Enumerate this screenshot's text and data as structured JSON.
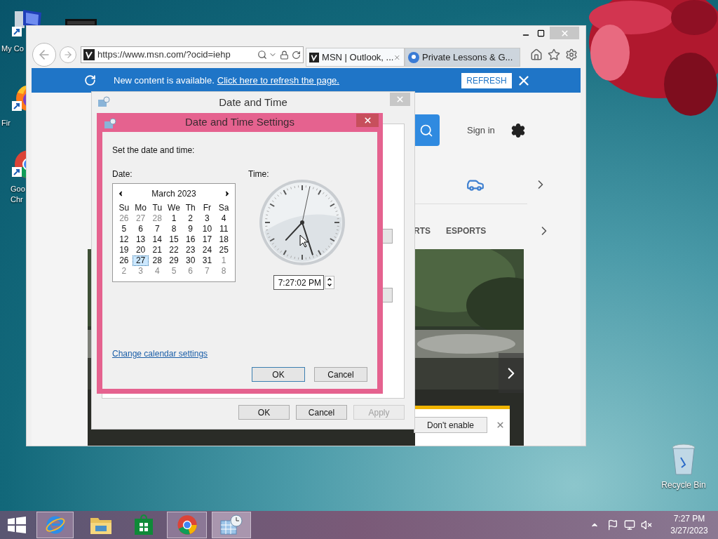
{
  "desktop": {
    "icons": [
      {
        "kind": "computer",
        "lines": [
          "My Co"
        ]
      },
      {
        "kind": "firefox",
        "lines": [
          "Fir"
        ]
      },
      {
        "kind": "chrome",
        "lines": [
          "Goo",
          "Chr"
        ]
      }
    ],
    "recycle_bin": {
      "label": "Recycle Bin"
    }
  },
  "browser": {
    "address": "https://www.msn.com/?ocid=iehp",
    "tabs": [
      {
        "label": "MSN | Outlook, ...",
        "selected": true
      },
      {
        "label": "Private Lessons & G...",
        "selected": false
      }
    ],
    "banner": {
      "text": "New content is available.",
      "link": "Click here to refresh the page.",
      "button": "REFRESH"
    },
    "page": {
      "sign_in": "Sign in",
      "nav_items": [
        "RTS",
        "ESPORTS"
      ],
      "notification": {
        "button": "Don't enable"
      }
    }
  },
  "date_time_window": {
    "title": "Date and Time",
    "buttons": [
      {
        "label": "OK",
        "disabled": false
      },
      {
        "label": "Cancel",
        "disabled": false
      },
      {
        "label": "Apply",
        "disabled": true
      }
    ]
  },
  "settings_dialog": {
    "title": "Date and Time Settings",
    "prompt": "Set the date and time:",
    "date_label": "Date:",
    "time_label": "Time:",
    "calendar": {
      "month": "March 2023",
      "weekdays": [
        "Su",
        "Mo",
        "Tu",
        "We",
        "Th",
        "Fr",
        "Sa"
      ],
      "weeks": [
        [
          {
            "day": "26",
            "other_month": true,
            "selected": false
          },
          {
            "day": "27",
            "other_month": true,
            "selected": false
          },
          {
            "day": "28",
            "other_month": true,
            "selected": false
          },
          {
            "day": "1",
            "other_month": false,
            "selected": false
          },
          {
            "day": "2",
            "other_month": false,
            "selected": false
          },
          {
            "day": "3",
            "other_month": false,
            "selected": false
          },
          {
            "day": "4",
            "other_month": false,
            "selected": false
          }
        ],
        [
          {
            "day": "5",
            "other_month": false,
            "selected": false
          },
          {
            "day": "6",
            "other_month": false,
            "selected": false
          },
          {
            "day": "7",
            "other_month": false,
            "selected": false
          },
          {
            "day": "8",
            "other_month": false,
            "selected": false
          },
          {
            "day": "9",
            "other_month": false,
            "selected": false
          },
          {
            "day": "10",
            "other_month": false,
            "selected": false
          },
          {
            "day": "11",
            "other_month": false,
            "selected": false
          }
        ],
        [
          {
            "day": "12",
            "other_month": false,
            "selected": false
          },
          {
            "day": "13",
            "other_month": false,
            "selected": false
          },
          {
            "day": "14",
            "other_month": false,
            "selected": false
          },
          {
            "day": "15",
            "other_month": false,
            "selected": false
          },
          {
            "day": "16",
            "other_month": false,
            "selected": false
          },
          {
            "day": "17",
            "other_month": false,
            "selected": false
          },
          {
            "day": "18",
            "other_month": false,
            "selected": false
          }
        ],
        [
          {
            "day": "19",
            "other_month": false,
            "selected": false
          },
          {
            "day": "20",
            "other_month": false,
            "selected": false
          },
          {
            "day": "21",
            "other_month": false,
            "selected": false
          },
          {
            "day": "22",
            "other_month": false,
            "selected": false
          },
          {
            "day": "23",
            "other_month": false,
            "selected": false
          },
          {
            "day": "24",
            "other_month": false,
            "selected": false
          },
          {
            "day": "25",
            "other_month": false,
            "selected": false
          }
        ],
        [
          {
            "day": "26",
            "other_month": false,
            "selected": false
          },
          {
            "day": "27",
            "other_month": false,
            "selected": true
          },
          {
            "day": "28",
            "other_month": false,
            "selected": false
          },
          {
            "day": "29",
            "other_month": false,
            "selected": false
          },
          {
            "day": "30",
            "other_month": false,
            "selected": false
          },
          {
            "day": "31",
            "other_month": false,
            "selected": false
          },
          {
            "day": "1",
            "other_month": true,
            "selected": false
          }
        ],
        [
          {
            "day": "2",
            "other_month": true,
            "selected": false
          },
          {
            "day": "3",
            "other_month": true,
            "selected": false
          },
          {
            "day": "4",
            "other_month": true,
            "selected": false
          },
          {
            "day": "5",
            "other_month": true,
            "selected": false
          },
          {
            "day": "6",
            "other_month": true,
            "selected": false
          },
          {
            "day": "7",
            "other_month": true,
            "selected": false
          },
          {
            "day": "8",
            "other_month": true,
            "selected": false
          }
        ]
      ]
    },
    "time": "7:27:02 PM",
    "link": "Change calendar settings",
    "buttons": [
      {
        "label": "OK",
        "default": true
      },
      {
        "label": "Cancel",
        "default": false
      }
    ]
  },
  "taskbar": {
    "apps": [
      {
        "kind": "ie",
        "running": true,
        "selected": false
      },
      {
        "kind": "explorer",
        "running": false,
        "selected": false
      },
      {
        "kind": "store",
        "running": false,
        "selected": false
      },
      {
        "kind": "chrome",
        "running": true,
        "selected": false
      },
      {
        "kind": "datetime",
        "running": true,
        "selected": true
      }
    ],
    "clock": {
      "time": "7:27 PM",
      "date": "3/27/2023"
    }
  }
}
